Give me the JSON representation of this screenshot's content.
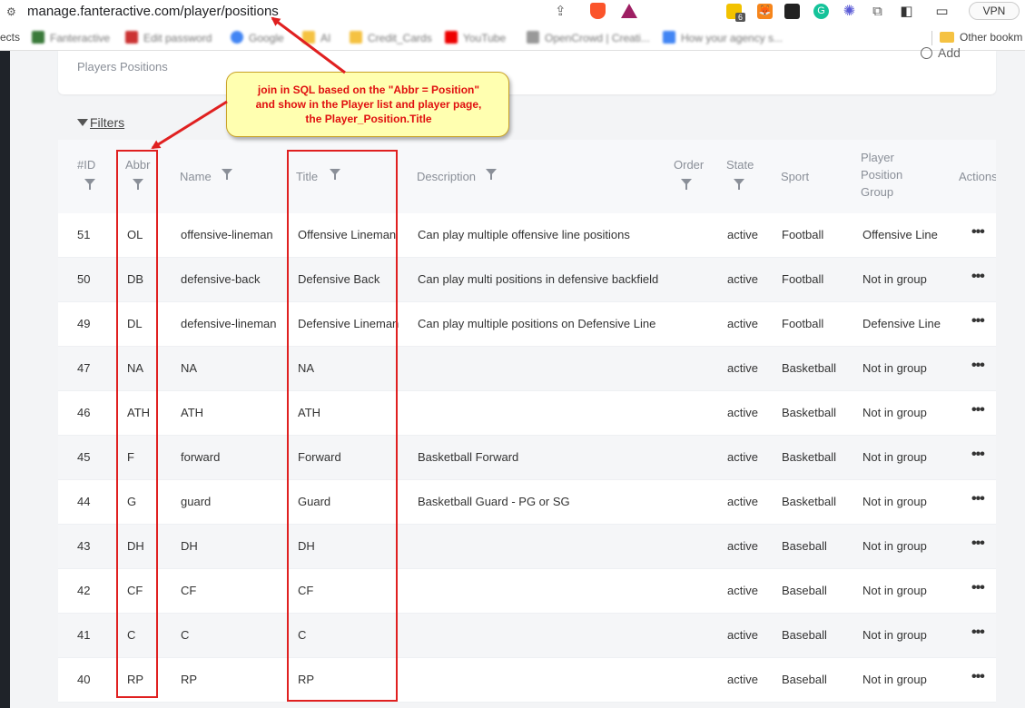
{
  "browser": {
    "url": "manage.fanteractive.com/player/positions",
    "vpn_label": "VPN",
    "ext_badge": "6",
    "bookmarks": {
      "first_partial": "ects",
      "items": [
        "Fanteractive",
        "Edit password",
        "Google",
        "AI",
        "Credit_Cards",
        "YouTube",
        "OpenCrowd | Creati...",
        "How your agency s..."
      ],
      "other": "Other bookm"
    }
  },
  "header": {
    "subtitle": "Players Positions",
    "add_label": "Add"
  },
  "filters_label": "Filters",
  "table": {
    "columns": {
      "id": "#ID",
      "abbr": "Abbr",
      "name": "Name",
      "title": "Title",
      "description": "Description",
      "order": "Order",
      "state": "State",
      "sport": "Sport",
      "group_l1": "Player",
      "group_l2": "Position",
      "group_l3": "Group",
      "actions": "Actions"
    },
    "rows": [
      {
        "id": "51",
        "abbr": "OL",
        "name": "offensive-lineman",
        "title": "Offensive Lineman",
        "description": "Can play multiple offensive line positions",
        "state": "active",
        "sport": "Football",
        "group": "Offensive Line"
      },
      {
        "id": "50",
        "abbr": "DB",
        "name": "defensive-back",
        "title": "Defensive Back",
        "description": "Can play multi positions in defensive backfield",
        "state": "active",
        "sport": "Football",
        "group": "Not in group"
      },
      {
        "id": "49",
        "abbr": "DL",
        "name": "defensive-lineman",
        "title": "Defensive Lineman",
        "description": "Can play multiple positions on Defensive Line",
        "state": "active",
        "sport": "Football",
        "group": "Defensive Line"
      },
      {
        "id": "47",
        "abbr": "NA",
        "name": "NA",
        "title": "NA",
        "description": "",
        "state": "active",
        "sport": "Basketball",
        "group": "Not in group"
      },
      {
        "id": "46",
        "abbr": "ATH",
        "name": "ATH",
        "title": "ATH",
        "description": "",
        "state": "active",
        "sport": "Basketball",
        "group": "Not in group"
      },
      {
        "id": "45",
        "abbr": "F",
        "name": "forward",
        "title": "Forward",
        "description": "Basketball Forward",
        "state": "active",
        "sport": "Basketball",
        "group": "Not in group"
      },
      {
        "id": "44",
        "abbr": "G",
        "name": "guard",
        "title": "Guard",
        "description": "Basketball Guard - PG or SG",
        "state": "active",
        "sport": "Basketball",
        "group": "Not in group"
      },
      {
        "id": "43",
        "abbr": "DH",
        "name": "DH",
        "title": "DH",
        "description": "",
        "state": "active",
        "sport": "Baseball",
        "group": "Not in group"
      },
      {
        "id": "42",
        "abbr": "CF",
        "name": "CF",
        "title": "CF",
        "description": "",
        "state": "active",
        "sport": "Baseball",
        "group": "Not in group"
      },
      {
        "id": "41",
        "abbr": "C",
        "name": "C",
        "title": "C",
        "description": "",
        "state": "active",
        "sport": "Baseball",
        "group": "Not in group"
      },
      {
        "id": "40",
        "abbr": "RP",
        "name": "RP",
        "title": "RP",
        "description": "",
        "state": "active",
        "sport": "Baseball",
        "group": "Not in group"
      }
    ],
    "actions_glyph": "•••"
  },
  "annotation": {
    "line1": "join in SQL based on the \"Abbr = Position\"",
    "line2": "and show in the Player list and player page,",
    "line3": "the Player_Position.Title"
  },
  "colors": {
    "annotation_red": "#e02020",
    "callout_bg": "#ffffb0"
  }
}
